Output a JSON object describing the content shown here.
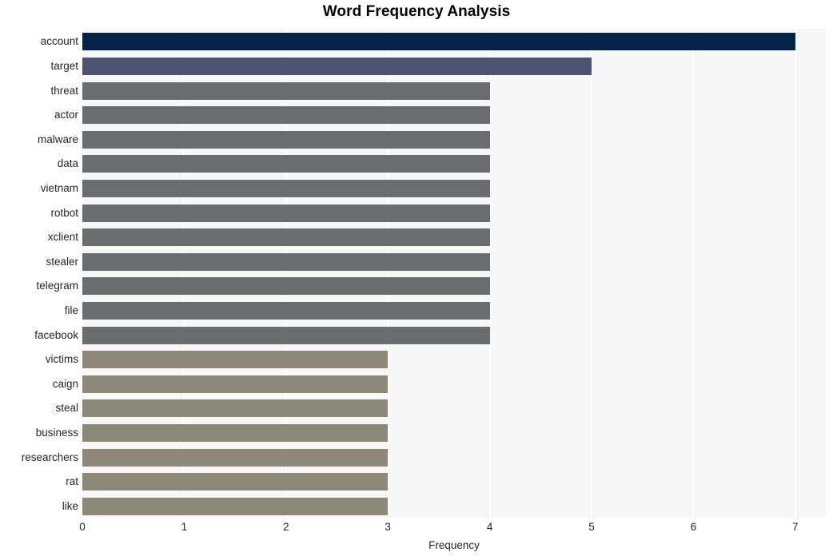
{
  "chart_data": {
    "type": "bar",
    "orientation": "horizontal",
    "title": "Word Frequency Analysis",
    "xlabel": "Frequency",
    "ylabel": "",
    "xlim": [
      0,
      7.3
    ],
    "xticks": [
      0,
      1,
      2,
      3,
      4,
      5,
      6,
      7
    ],
    "xtick_labels": [
      "0",
      "1",
      "2",
      "3",
      "4",
      "5",
      "6",
      "7"
    ],
    "grid": true,
    "grid_axis": "x",
    "legend": "none",
    "categories": [
      "account",
      "target",
      "threat",
      "actor",
      "malware",
      "data",
      "vietnam",
      "rotbot",
      "xclient",
      "stealer",
      "telegram",
      "file",
      "facebook",
      "victims",
      "caign",
      "steal",
      "business",
      "researchers",
      "rat",
      "like"
    ],
    "values": [
      7,
      5,
      4,
      4,
      4,
      4,
      4,
      4,
      4,
      4,
      4,
      4,
      4,
      3,
      3,
      3,
      3,
      3,
      3,
      3
    ],
    "bar_colors": [
      "#03234b",
      "#4c5472",
      "#6b6c70",
      "#6b6c70",
      "#6b6c70",
      "#6b6c70",
      "#6b6c70",
      "#6b6c70",
      "#6b6c70",
      "#6b6c70",
      "#6b6c70",
      "#6b6c70",
      "#6b6c70",
      "#8e8878",
      "#8e8878",
      "#8e8878",
      "#8e8878",
      "#8e8878",
      "#8e8878",
      "#8e8878"
    ],
    "palette": {
      "value_7": "#03234b",
      "value_5": "#4c5472",
      "value_4": "#6b6c70",
      "value_3": "#8e8878"
    },
    "style": {
      "plot_background": "#f7f7f7",
      "figure_background": "#ffffff",
      "gridline_color": "#ffffff",
      "text_color": "#262626"
    }
  }
}
